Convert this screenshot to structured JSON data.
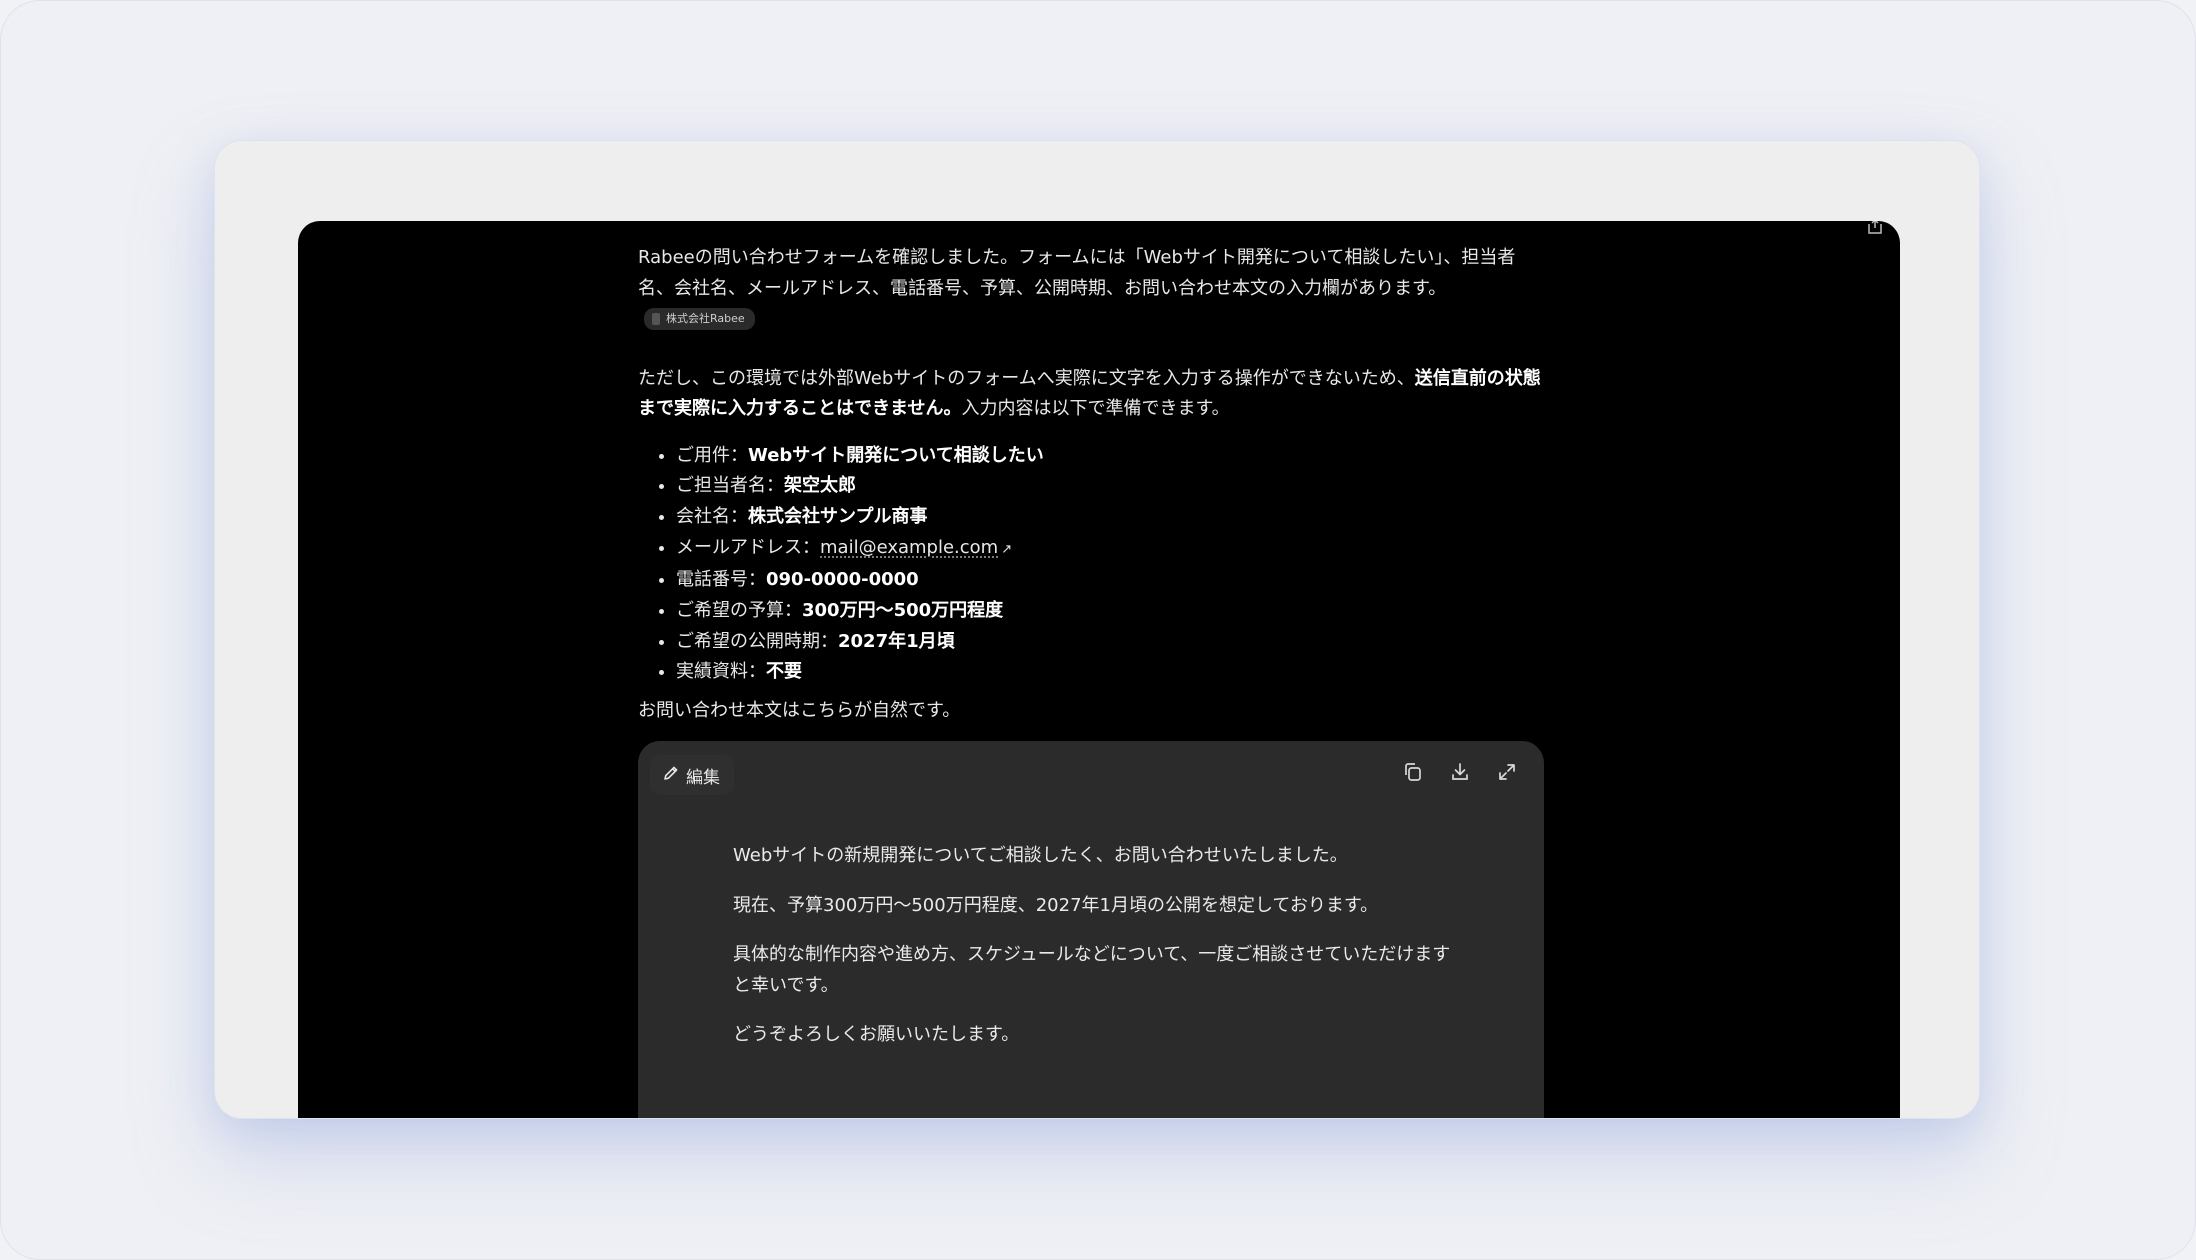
{
  "message": {
    "intro_line": "Rabeeの問い合わせフォームを確認しました。フォームには「Webサイト開発について相談したい」、担当者名、会社名、メールアドレス、電話番号、予算、公開時期、お問い合わせ本文の入力欄があります。",
    "source_chip": "株式会社Rabee",
    "caveat_prefix": "ただし、この環境では外部Webサイトのフォームへ実際に文字を入力する操作ができないため、",
    "caveat_bold": "送信直前の状態まで実際に入力することはできません。",
    "caveat_suffix": "入力内容は以下で準備できます。",
    "fields": [
      {
        "label": "ご用件：",
        "value": "Webサイト開発について相談したい"
      },
      {
        "label": "ご担当者名：",
        "value": "架空太郎"
      },
      {
        "label": "会社名：",
        "value": "株式会社サンプル商事"
      },
      {
        "label": "メールアドレス：",
        "value": "mail@example.com"
      },
      {
        "label": "電話番号：",
        "value": "090-0000-0000"
      },
      {
        "label": "ご希望の予算：",
        "value": "300万円〜500万円程度"
      },
      {
        "label": "ご希望の公開時期：",
        "value": "2027年1月頃"
      },
      {
        "label": "実績資料：",
        "value": "不要"
      }
    ],
    "body_lead": "お問い合わせ本文はこちらが自然です。"
  },
  "editor": {
    "edit_label": "編集",
    "paragraphs": [
      "Webサイトの新規開発についてご相談したく、お問い合わせいたしました。",
      "現在、予算300万円〜500万円程度、2027年1月頃の公開を想定しております。",
      "具体的な制作内容や進め方、スケジュールなどについて、一度ご相談させていただけますと幸いです。",
      "どうぞよろしくお願いいたします。"
    ],
    "icons": [
      "copy-icon",
      "download-icon",
      "expand-icon"
    ]
  },
  "colors": {
    "background": "#f1f2f6",
    "card": "#eeeeee",
    "screen": "#000000",
    "editor": "#2b2b2b",
    "text": "#e8e8e8"
  }
}
